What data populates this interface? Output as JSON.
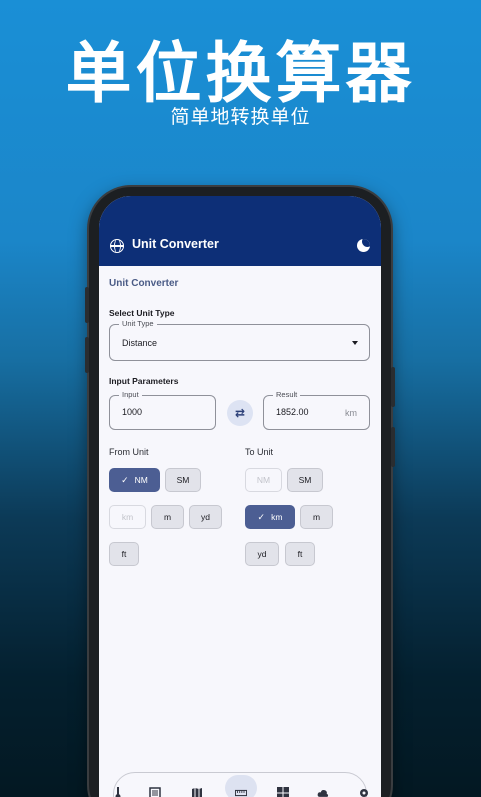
{
  "promo": {
    "title": "单位换算器",
    "subtitle": "简单地转换单位"
  },
  "appbar": {
    "title": "Unit Converter",
    "left_icon": "globe-icon",
    "right_icon": "moon-icon"
  },
  "page": {
    "section_title": "Unit Converter",
    "select_unit_type_label": "Select Unit Type",
    "unit_type_legend": "Unit Type",
    "unit_type_value": "Distance",
    "input_parameters_label": "Input Parameters",
    "input_legend": "Input",
    "input_value": "1000",
    "result_legend": "Result",
    "result_value": "1852.00",
    "result_suffix": "km"
  },
  "from_unit": {
    "title": "From Unit",
    "chips": [
      {
        "label": "NM",
        "selected": true
      },
      {
        "label": "SM"
      },
      {
        "label": "km",
        "disabled": true
      },
      {
        "label": "m"
      },
      {
        "label": "yd"
      },
      {
        "label": "ft"
      }
    ]
  },
  "to_unit": {
    "title": "To Unit",
    "chips": [
      {
        "label": "NM",
        "disabled": true
      },
      {
        "label": "SM"
      },
      {
        "label": "km",
        "selected": true
      },
      {
        "label": "m"
      },
      {
        "label": "yd"
      },
      {
        "label": "ft"
      }
    ]
  },
  "check_glyph": "✓",
  "swap_glyph": "⇄",
  "colors": {
    "appbar": "#0d2f77",
    "selected_chip": "#4c5e93",
    "background_top": "#1a8fd6"
  },
  "bottom_nav": {
    "icons": [
      "thermometer-icon",
      "list-icon",
      "map-icon",
      "ruler-icon",
      "grid-icon",
      "cloud-icon",
      "gear-icon"
    ],
    "active": "ruler-icon"
  }
}
